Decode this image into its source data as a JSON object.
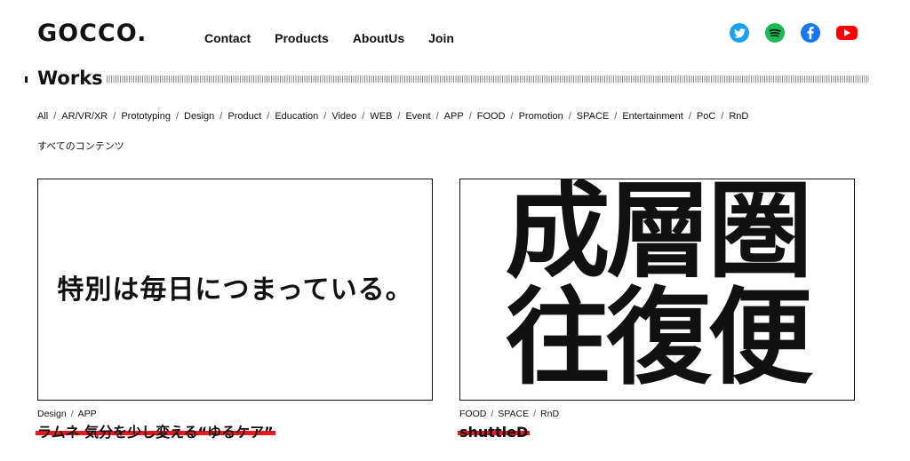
{
  "header": {
    "logo": "GOCCO.",
    "nav": [
      "Contact",
      "Products",
      "AboutUs",
      "Join"
    ],
    "social": [
      {
        "name": "twitter",
        "color": "#1da1f2"
      },
      {
        "name": "spotify",
        "color": "#1db954"
      },
      {
        "name": "facebook",
        "color": "#1877f2"
      },
      {
        "name": "youtube",
        "color": "#ff0000"
      }
    ]
  },
  "section": {
    "title": "Works",
    "categories": [
      "All",
      "AR/VR/XR",
      "Prototyping",
      "Design",
      "Product",
      "Education",
      "Video",
      "WEB",
      "Event",
      "APP",
      "FOOD",
      "Promotion",
      "SPACE",
      "Entertainment",
      "PoC",
      "RnD"
    ],
    "separator": "/",
    "subtitle": "すべてのコンテンツ"
  },
  "works": [
    {
      "thumb_text": "特別は毎日につまっている。",
      "tags": [
        "Design",
        "APP"
      ],
      "title": "ラムネ 気分を少し変える“ゆるケア”"
    },
    {
      "thumb_lines": [
        "成層圏",
        "往復便"
      ],
      "tags": [
        "FOOD",
        "SPACE",
        "RnD"
      ],
      "title": "shuttleD"
    }
  ],
  "colors": {
    "accent": "#e8191e",
    "text": "#111111"
  }
}
